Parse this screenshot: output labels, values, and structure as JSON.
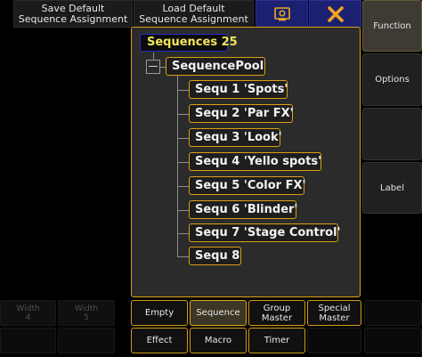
{
  "toolbar": {
    "save_default": [
      "Save Default",
      "Sequence Assignment"
    ],
    "load_default": [
      "Load Default",
      "Sequence Assignment"
    ],
    "screen_icon": "screen-icon",
    "close_icon": "close-icon"
  },
  "tree": {
    "root_label": "Sequences 25",
    "pool_label": "SequencePool",
    "items": [
      {
        "label": "Sequ 1 'Spots'"
      },
      {
        "label": "Sequ 2 'Par FX'"
      },
      {
        "label": "Sequ 3 'Look'"
      },
      {
        "label": "Sequ 4 'Yello spots'"
      },
      {
        "label": "Sequ 5 'Color FX'"
      },
      {
        "label": "Sequ 6 'Blinder'"
      },
      {
        "label": "Sequ 7 'Stage Control'"
      },
      {
        "label": "Sequ 8"
      }
    ]
  },
  "right_panel": {
    "function": "Function",
    "options": "Options",
    "label": "Label"
  },
  "left_panel": {
    "width4": [
      "Width",
      "4"
    ],
    "width5": [
      "Width",
      "5"
    ]
  },
  "bottom": {
    "row1": [
      {
        "lines": [
          "Empty"
        ]
      },
      {
        "lines": [
          "Sequence"
        ]
      },
      {
        "lines": [
          "Group",
          "Master"
        ]
      },
      {
        "lines": [
          "Special",
          "Master"
        ]
      }
    ],
    "row2": [
      {
        "lines": [
          "Effect"
        ]
      },
      {
        "lines": [
          "Macro"
        ]
      },
      {
        "lines": [
          "Timer"
        ]
      }
    ]
  },
  "colors": {
    "accent_gold": "#d9a015",
    "title_yellow": "#f3e45a",
    "toolbar_blue": "#1c2070",
    "close_orange": "#f3a51e"
  }
}
